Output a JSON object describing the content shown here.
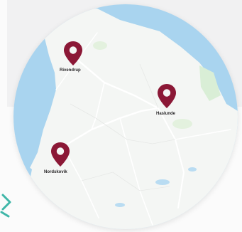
{
  "map": {
    "water_color": "#a9d4ef",
    "land_color": "#f4f6f4",
    "park_color": "#d9eed6",
    "road_color": "#ffffff",
    "marker_color": "#8b1836"
  },
  "markers": [
    {
      "name": "Rivendrup",
      "icon": "map-pin-icon"
    },
    {
      "name": "Haslunde",
      "icon": "map-pin-icon"
    },
    {
      "name": "Nordskovik",
      "icon": "map-pin-icon"
    }
  ],
  "decoration": {
    "icon": "teal-bracket-icon",
    "color": "#3fb6a8"
  }
}
